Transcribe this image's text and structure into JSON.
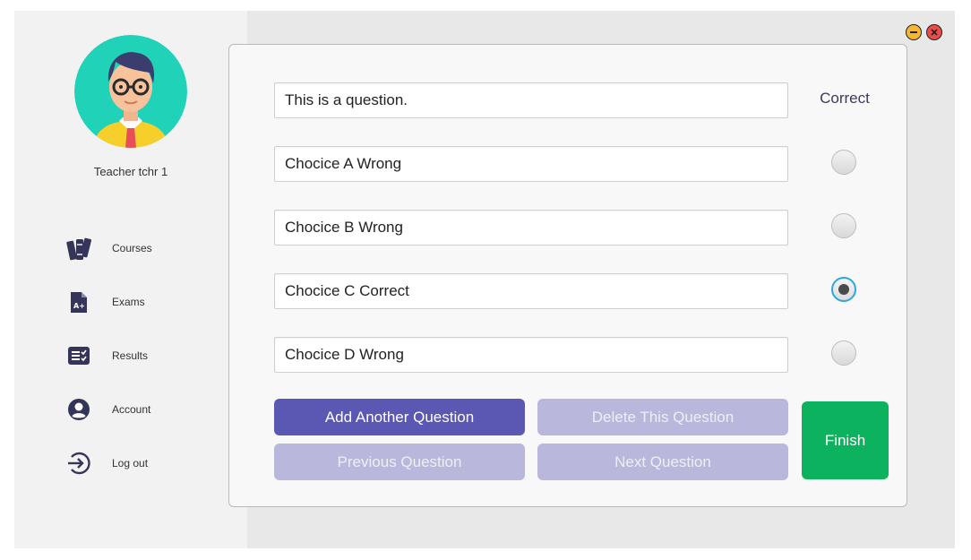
{
  "window_controls": {
    "minimize_color": "#f5b731",
    "close_color": "#ef4a4a"
  },
  "sidebar": {
    "user_name": "Teacher tchr 1",
    "items": [
      {
        "label": "Courses",
        "icon": "books-icon"
      },
      {
        "label": "Exams",
        "icon": "exam-document-icon"
      },
      {
        "label": "Results",
        "icon": "results-list-icon"
      },
      {
        "label": "Account",
        "icon": "user-account-icon"
      },
      {
        "label": "Log out",
        "icon": "logout-icon"
      }
    ]
  },
  "question_form": {
    "question": "This is a question.",
    "correct_header": "Correct",
    "choices": [
      {
        "text": "Chocice A Wrong",
        "correct": false
      },
      {
        "text": "Chocice B Wrong",
        "correct": false
      },
      {
        "text": "Chocice C Correct",
        "correct": true
      },
      {
        "text": "Chocice D Wrong",
        "correct": false
      }
    ],
    "buttons": {
      "add": "Add Another Question",
      "delete": "Delete This Question",
      "previous": "Previous Question",
      "next": "Next Question",
      "finish": "Finish"
    }
  },
  "colors": {
    "primary": "#5b58b3",
    "disabled": "#b9b8dc",
    "finish": "#0db25f",
    "nav_icon": "#35355a"
  }
}
